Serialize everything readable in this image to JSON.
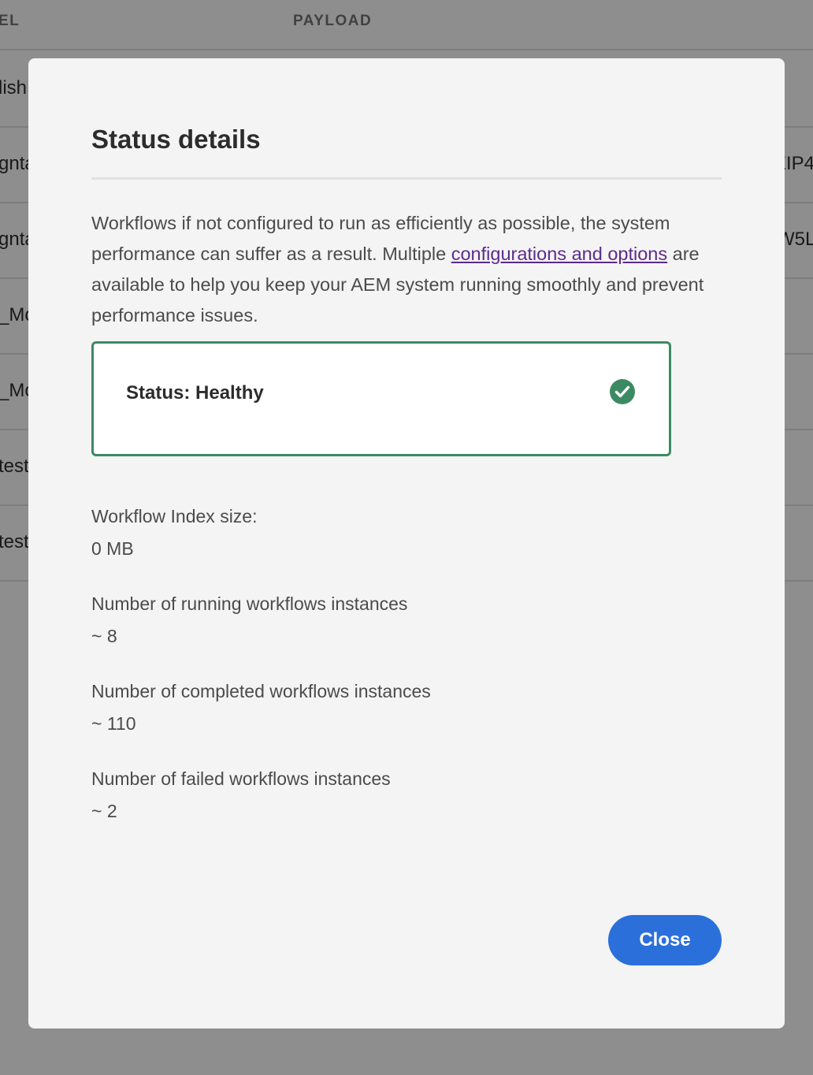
{
  "background_table": {
    "headers": [
      "EL",
      "PAYLOAD"
    ],
    "rows": [
      {
        "col1": "lish",
        "col3": ""
      },
      {
        "col1": "gnta",
        "col3": "EIP4"
      },
      {
        "col1": "gnta",
        "col3": "W5L"
      },
      {
        "col1": "_Mo",
        "col3": ""
      },
      {
        "col1": "_Mo",
        "col3": ""
      },
      {
        "col1": "test",
        "col3": ""
      },
      {
        "col1": "test",
        "col3": ""
      }
    ]
  },
  "dialog": {
    "title": "Status details",
    "description_before": "Workflows if not configured to run as efficiently as possible, the system performance can suffer as a result. Multiple ",
    "description_link": "configurations and options",
    "description_after": " are available to help you keep your AEM system running smoothly and prevent performance issues.",
    "status": {
      "label": "Status: Healthy",
      "icon": "check-circle-icon",
      "color": "#3c8a64"
    },
    "metrics": [
      {
        "label": "Workflow Index size:",
        "value": "0 MB"
      },
      {
        "label": "Number of running workflows instances",
        "value": "~ 8"
      },
      {
        "label": "Number of completed workflows instances",
        "value": "~ 110"
      },
      {
        "label": "Number of failed workflows instances",
        "value": "~ 2"
      }
    ],
    "close_label": "Close",
    "accent_color": "#2b6fdb",
    "link_color": "#5c2b8c"
  }
}
